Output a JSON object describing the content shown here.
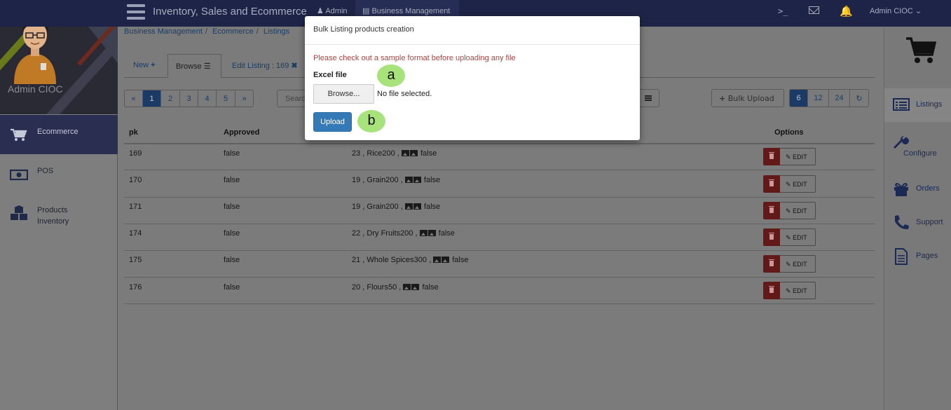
{
  "header": {
    "app_title": "Inventory, Sales and Ecommerce",
    "admin_label": "Admin",
    "business_label": "Business Management",
    "terminal_label": ">_",
    "user_label": "Admin CIOC"
  },
  "sidebar": {
    "profile_name": "Admin CIOC",
    "items": [
      {
        "label": "Ecommerce",
        "icon": "cart-icon",
        "active": true
      },
      {
        "label": "POS",
        "icon": "money-icon",
        "active": false
      },
      {
        "label": "Products",
        "label2": "Inventory",
        "icon": "cubes-icon",
        "active": false
      }
    ]
  },
  "rightbar": {
    "items": [
      {
        "label": "Listings",
        "icon": "list-icon"
      },
      {
        "label": "Configure",
        "icon": "wrench-icon"
      },
      {
        "label": "Orders",
        "icon": "gift-icon"
      },
      {
        "label": "Support",
        "icon": "phone-icon"
      },
      {
        "label": "Pages",
        "icon": "file-icon"
      }
    ]
  },
  "breadcrumb": [
    "Business Management",
    "Ecommerce",
    "Listings"
  ],
  "tabs": {
    "new_label": "New",
    "browse_label": "Browse",
    "edit_label": "Edit Listing : 169"
  },
  "pager": [
    "«",
    "1",
    "2",
    "3",
    "4",
    "5",
    "»"
  ],
  "search_placeholder": "Search",
  "bulk_upload_label": "Bulk Upload",
  "page_sizes": [
    "6",
    "12",
    "24"
  ],
  "table": {
    "headers": {
      "pk": "pk",
      "approved": "Approved",
      "options": "Options"
    },
    "edit_label": "EDIT",
    "rows": [
      {
        "pk": "169",
        "approved": "false",
        "pre": "23 , Rice200 ,",
        "post": "false"
      },
      {
        "pk": "170",
        "approved": "false",
        "pre": "19 , Grain200 ,",
        "post": "false"
      },
      {
        "pk": "171",
        "approved": "false",
        "pre": "19 , Grain200 ,",
        "post": "false"
      },
      {
        "pk": "174",
        "approved": "false",
        "pre": "22 , Dry Fruits200 ,",
        "post": "false"
      },
      {
        "pk": "175",
        "approved": "false",
        "pre": "21 , Whole Spices300 ,",
        "post": "false"
      },
      {
        "pk": "176",
        "approved": "false",
        "pre": "20 , Flours50 ,",
        "post": "false"
      }
    ]
  },
  "modal": {
    "title": "Bulk Listing products creation",
    "warning": "Please check out a sample format before uploading any file",
    "field_label": "Excel file",
    "browse_label": "Browse...",
    "file_status": "No file selected.",
    "upload_label": "Upload"
  },
  "markers": {
    "a": "a",
    "b": "b"
  },
  "colors": {
    "topbar": "#1d2447",
    "primary": "#337ab7",
    "danger": "#611a18",
    "warning_text": "#a94442",
    "marker": "#a8e27a"
  }
}
